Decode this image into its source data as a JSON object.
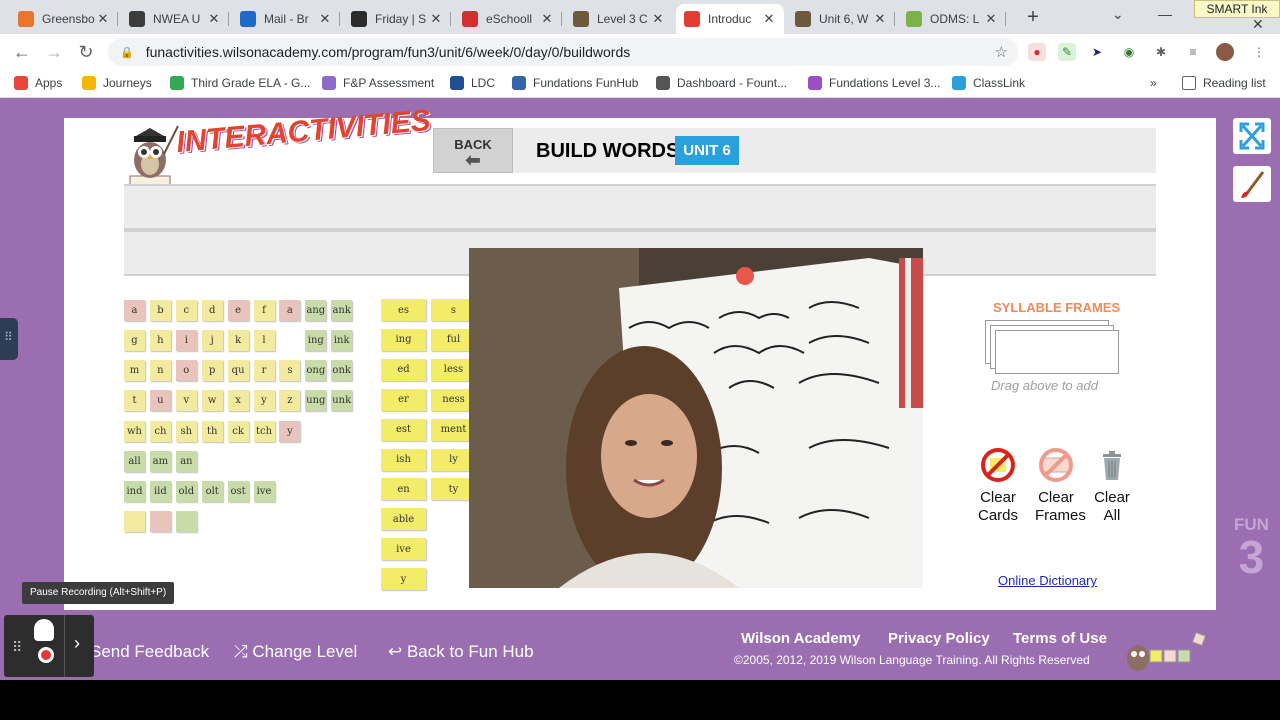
{
  "browser": {
    "tabs": [
      {
        "title": "Greensbo",
        "icon": "greensboro-favicon-icon",
        "color": "#e9762b"
      },
      {
        "title": "NWEA U",
        "icon": "nwea-favicon-icon",
        "color": "#3c3c3c"
      },
      {
        "title": "Mail - Br",
        "icon": "outlook-favicon-icon",
        "color": "#1f6ac8"
      },
      {
        "title": "Friday | S",
        "icon": "schoology-favicon-icon",
        "color": "#2b2b2b"
      },
      {
        "title": "eSchooll",
        "icon": "eschool-favicon-icon",
        "color": "#d32f2f"
      },
      {
        "title": "Level 3 C",
        "icon": "owl-favicon-icon",
        "color": "#6d5a3c"
      },
      {
        "title": "Introduc",
        "icon": "in-favicon-icon",
        "color": "#e23d32"
      },
      {
        "title": "Unit 6, W",
        "icon": "owl-favicon-icon",
        "color": "#6d5a3c"
      },
      {
        "title": "ODMS: L",
        "icon": "odms-favicon-icon",
        "color": "#7bb24a"
      }
    ],
    "active_tab": 6,
    "smart_ink_label": "SMART Ink",
    "url": "funactivities.wilsonacademy.com/program/fun3/unit/6/week/0/day/0/buildwords",
    "bookmarks": [
      {
        "label": "Apps",
        "color": "#e8453c"
      },
      {
        "label": "Journeys",
        "color": "#f2b705"
      },
      {
        "label": "Third Grade ELA - G...",
        "color": "#34a853"
      },
      {
        "label": "F&P Assessment",
        "color": "#8f6bc9"
      },
      {
        "label": "LDC",
        "color": "#1d4f91"
      },
      {
        "label": "Fundations FunHub",
        "color": "#3565a8"
      },
      {
        "label": "Dashboard - Fount...",
        "color": "#555555"
      },
      {
        "label": "Fundations Level 3...",
        "color": "#9b4fc4"
      },
      {
        "label": "ClassLink",
        "color": "#2d9fd8"
      }
    ],
    "bookmarks_overflow": "»",
    "reading_list_label": "Reading list"
  },
  "app": {
    "logo_text": "INTERACTIVITIES",
    "back_label": "BACK",
    "title": "BUILD WORDS",
    "unit_badge": "UNIT 6",
    "letter_cards": [
      [
        "a",
        "b",
        "c",
        "d",
        "e",
        "f",
        "a",
        "ang",
        "ank"
      ],
      [
        "g",
        "h",
        "i",
        "j",
        "k",
        "l",
        "",
        "ing",
        "ink"
      ],
      [
        "m",
        "n",
        "o",
        "p",
        "qu",
        "r",
        "s",
        "ong",
        "onk"
      ],
      [
        "t",
        "u",
        "v",
        "w",
        "x",
        "y",
        "z",
        "ung",
        "unk"
      ],
      [
        "wh",
        "ch",
        "sh",
        "th",
        "ck",
        "tch",
        "y"
      ],
      [
        "all",
        "am",
        "an"
      ],
      [
        "ind",
        "ild",
        "old",
        "olt",
        "ost",
        "ive"
      ],
      [
        "",
        "",
        ""
      ]
    ],
    "card_colors": [
      [
        "#e8c4bc",
        "#f2ea9e",
        "#f2ea9e",
        "#f2ea9e",
        "#e8c4bc",
        "#f2ea9e",
        "#e8c4bc",
        "#c8dcaa",
        "#c8dcaa"
      ],
      [
        "#f2ea9e",
        "#f2ea9e",
        "#e8c4bc",
        "#f2ea9e",
        "#f2ea9e",
        "#f2ea9e",
        "",
        "#c8dcaa",
        "#c8dcaa"
      ],
      [
        "#f2ea9e",
        "#f2ea9e",
        "#e8c4bc",
        "#f2ea9e",
        "#f2ea9e",
        "#f2ea9e",
        "#f2ea9e",
        "#c8dcaa",
        "#c8dcaa"
      ],
      [
        "#f2ea9e",
        "#e8c4bc",
        "#f2ea9e",
        "#f2ea9e",
        "#f2ea9e",
        "#f2ea9e",
        "#f2ea9e",
        "#c8dcaa",
        "#c8dcaa"
      ],
      [
        "#f2ea9e",
        "#f2ea9e",
        "#f2ea9e",
        "#f2ea9e",
        "#f2ea9e",
        "#f2ea9e",
        "#e8c4bc"
      ],
      [
        "#c8dcaa",
        "#c8dcaa",
        "#c8dcaa"
      ],
      [
        "#c8dcaa",
        "#c8dcaa",
        "#c8dcaa",
        "#c8dcaa",
        "#c8dcaa",
        "#c8dcaa"
      ],
      [
        "#f2ea9e",
        "#e8c4bc",
        "#c8dcaa"
      ]
    ],
    "suffix_col1": [
      "es",
      "ing",
      "ed",
      "er",
      "est",
      "ish",
      "en",
      "able",
      "ive",
      "y"
    ],
    "suffix_col2": [
      "s",
      "ful",
      "less",
      "ness",
      "ment",
      "ly",
      "ty"
    ],
    "syllable_frames_title": "SYLLABLE FRAMES",
    "drag_hint": "Drag above to add",
    "clear_cards_label": [
      "Clear",
      "Cards"
    ],
    "clear_frames_label": [
      "Clear",
      "Frames"
    ],
    "clear_all_label": [
      "Clear",
      "All"
    ],
    "online_dictionary": "Online Dictionary",
    "fun3_label": "FUN",
    "fun3_number": "3"
  },
  "footer": {
    "send_feedback": "Send Feedback",
    "change_level": "Change Level",
    "back_to_fun_hub": "Back to Fun Hub",
    "wilson_academy": "Wilson Academy",
    "privacy_policy": "Privacy Policy",
    "terms_of_use": "Terms of Use",
    "copyright": "©2005, 2012, 2019 Wilson Language Training. All Rights Reserved"
  },
  "recorder": {
    "tooltip": "Pause Recording (Alt+Shift+P)"
  },
  "colors": {
    "page_bg": "#9b6db1",
    "unit_badge": "#2aa0dd",
    "suffix_card": "#f3ec68",
    "link": "#1a29c9"
  }
}
